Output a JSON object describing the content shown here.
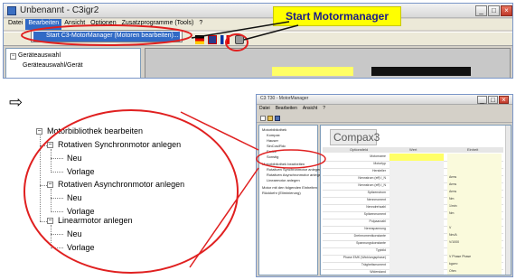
{
  "top_window": {
    "title": "Unbenannt - C3igr2",
    "menu": [
      "Datei",
      "Bearbeiten",
      "Ansicht",
      "Optionen",
      "Zusatzprogramme (Tools)",
      "?"
    ],
    "active_menu_index": 1,
    "dropdown_item": "Start C3-MotorManager (Motoren bearbeiten)...",
    "tree": [
      {
        "label": "Geräteauswahl"
      },
      {
        "label": "Geräteauswahl/Gerät"
      }
    ]
  },
  "callout": {
    "label": "Start Motormanager",
    "color": "#ffff00"
  },
  "arrow_icon": "right-arrow",
  "zoom_tree": {
    "root": "Motorbibliothek bearbeiten",
    "groups": [
      {
        "label": "Rotativen Synchronmotor anlegen",
        "children": [
          "Neu",
          "Vorlage"
        ]
      },
      {
        "label": "Rotativen Asynchronmotor anlegen",
        "children": [
          "Neu",
          "Vorlage"
        ]
      },
      {
        "label": "Linearmotor anlegen",
        "children": [
          "Neu",
          "Vorlage"
        ]
      }
    ]
  },
  "motor_manager": {
    "title": "C3 T30 - MotorManager",
    "menu": [
      "Datei",
      "Bearbeiten",
      "Ansicht",
      "?"
    ],
    "tree": [
      "Motorbibliothek",
      "Kompax",
      "Hauser",
      "SinCos/Rdc",
      "Ervice",
      "Sonstig",
      "Motorbibliothek bearbeiten",
      "Rotativen Synchronmotor anlegen",
      "Rotativen Asynchronmotor anlegen",
      "Linearmotor anlegen",
      "Motor mit den folgenden Einheiten",
      "Rückkehr (Eliminierung)"
    ],
    "logo": "Compax3",
    "columns": [
      "Optionsfeld",
      "Wert",
      "Einheit"
    ],
    "rows": [
      {
        "label": "Motorname",
        "unit": "",
        "highlight": true
      },
      {
        "label": "Motortyp",
        "unit": "",
        "highlight": false
      },
      {
        "label": "Hersteller",
        "unit": "",
        "highlight": false
      },
      {
        "label": "Nennstrom (eff) I_N",
        "unit": "Arms",
        "highlight": false
      },
      {
        "label": "Nennstrom (eff) I_N",
        "unit": "Arms",
        "highlight": false
      },
      {
        "label": "Spitzenstrom",
        "unit": "Arms",
        "highlight": false
      },
      {
        "label": "Nennmoment",
        "unit": "Nm",
        "highlight": false
      },
      {
        "label": "Nenndrehzahl",
        "unit": "1/min",
        "highlight": false
      },
      {
        "label": "Spitzenmoment",
        "unit": "Nm",
        "highlight": false
      },
      {
        "label": "Polpaarzahl",
        "unit": "",
        "highlight": false
      },
      {
        "label": "Nennspannung",
        "unit": "V",
        "highlight": false
      },
      {
        "label": "Drehmomentkonstante",
        "unit": "Nm/A",
        "highlight": false
      },
      {
        "label": "Spannungskonstante",
        "unit": "V/1000",
        "highlight": false
      },
      {
        "label": "Typbild",
        "unit": "",
        "highlight": false
      },
      {
        "label": "Phase EMK (Wicklungsphase)",
        "unit": "V Phase Phase",
        "highlight": false
      },
      {
        "label": "Trägheitsmoment",
        "unit": "kgcm²",
        "highlight": false
      },
      {
        "label": "Widerstand",
        "unit": "Ohm",
        "highlight": false
      }
    ]
  },
  "colors": {
    "annotation_red": "#e02020",
    "selection_blue": "#316ac5",
    "callout_yellow": "#ffff00"
  }
}
